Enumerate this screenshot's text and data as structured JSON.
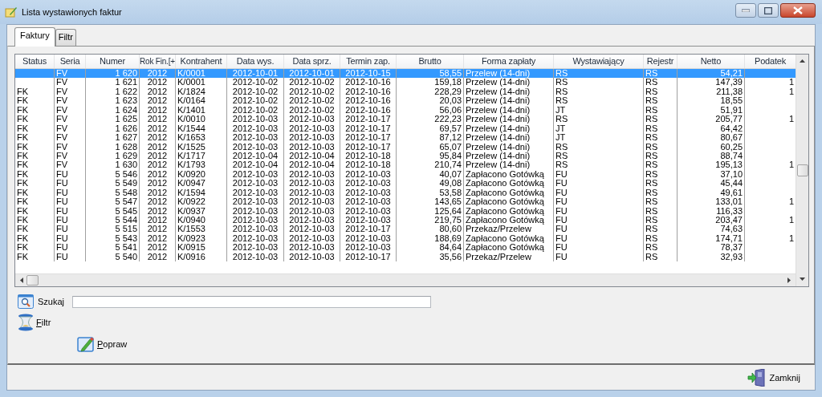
{
  "window": {
    "title": "Lista wystawionych faktur"
  },
  "tabs": [
    {
      "label": "Faktury",
      "selected": true
    },
    {
      "label": "Filtr",
      "selected": false
    }
  ],
  "table": {
    "columns": [
      "Status",
      "Seria",
      "Numer",
      "Rok Fin.[+",
      "Kontrahent",
      "Data wys.",
      "Data sprz.",
      "Termin zap.",
      "Brutto",
      "Forma zapłaty",
      "Wystawiający",
      "Rejestr",
      "Netto",
      "Podatek"
    ],
    "rows": [
      {
        "selected": true,
        "seria": "FV",
        "numer": "1 620",
        "rok": "2012",
        "kontrahent": "K/0001",
        "data_wys": "2012-10-01",
        "data_sprz": "2012-10-01",
        "termin": "2012-10-15",
        "brutto": "58,55",
        "forma": "Przelew (14-dni)",
        "wystawiajacy": "RS",
        "rejestr": "RS",
        "netto": "54,21"
      },
      {
        "selected": false,
        "seria": "FV",
        "numer": "1 621",
        "rok": "2012",
        "kontrahent": "K/0001",
        "data_wys": "2012-10-02",
        "data_sprz": "2012-10-02",
        "termin": "2012-10-16",
        "brutto": "159,18",
        "forma": "Przelew (14-dni)",
        "wystawiajacy": "RS",
        "rejestr": "RS",
        "netto": "147,39",
        "podatek": "1"
      },
      {
        "selected": false,
        "status": "FK",
        "seria": "FV",
        "numer": "1 622",
        "rok": "2012",
        "kontrahent": "K/1824",
        "data_wys": "2012-10-02",
        "data_sprz": "2012-10-02",
        "termin": "2012-10-16",
        "brutto": "228,29",
        "forma": "Przelew (14-dni)",
        "wystawiajacy": "RS",
        "rejestr": "RS",
        "netto": "211,38",
        "podatek": "1"
      },
      {
        "selected": false,
        "status": "FK",
        "seria": "FV",
        "numer": "1 623",
        "rok": "2012",
        "kontrahent": "K/0164",
        "data_wys": "2012-10-02",
        "data_sprz": "2012-10-02",
        "termin": "2012-10-16",
        "brutto": "20,03",
        "forma": "Przelew (14-dni)",
        "wystawiajacy": "RS",
        "rejestr": "RS",
        "netto": "18,55"
      },
      {
        "selected": false,
        "status": "FK",
        "seria": "FV",
        "numer": "1 624",
        "rok": "2012",
        "kontrahent": "K/1401",
        "data_wys": "2012-10-02",
        "data_sprz": "2012-10-02",
        "termin": "2012-10-16",
        "brutto": "56,06",
        "forma": "Przelew (14-dni)",
        "wystawiajacy": "JT",
        "rejestr": "RS",
        "netto": "51,91"
      },
      {
        "selected": false,
        "status": "FK",
        "seria": "FV",
        "numer": "1 625",
        "rok": "2012",
        "kontrahent": "K/0010",
        "data_wys": "2012-10-03",
        "data_sprz": "2012-10-03",
        "termin": "2012-10-17",
        "brutto": "222,23",
        "forma": "Przelew (14-dni)",
        "wystawiajacy": "RS",
        "rejestr": "RS",
        "netto": "205,77",
        "podatek": "1"
      },
      {
        "selected": false,
        "status": "FK",
        "seria": "FV",
        "numer": "1 626",
        "rok": "2012",
        "kontrahent": "K/1544",
        "data_wys": "2012-10-03",
        "data_sprz": "2012-10-03",
        "termin": "2012-10-17",
        "brutto": "69,57",
        "forma": "Przelew (14-dni)",
        "wystawiajacy": "JT",
        "rejestr": "RS",
        "netto": "64,42"
      },
      {
        "selected": false,
        "status": "FK",
        "seria": "FV",
        "numer": "1 627",
        "rok": "2012",
        "kontrahent": "K/1653",
        "data_wys": "2012-10-03",
        "data_sprz": "2012-10-03",
        "termin": "2012-10-17",
        "brutto": "87,12",
        "forma": "Przelew (14-dni)",
        "wystawiajacy": "JT",
        "rejestr": "RS",
        "netto": "80,67"
      },
      {
        "selected": false,
        "status": "FK",
        "seria": "FV",
        "numer": "1 628",
        "rok": "2012",
        "kontrahent": "K/1525",
        "data_wys": "2012-10-03",
        "data_sprz": "2012-10-03",
        "termin": "2012-10-17",
        "brutto": "65,07",
        "forma": "Przelew (14-dni)",
        "wystawiajacy": "RS",
        "rejestr": "RS",
        "netto": "60,25"
      },
      {
        "selected": false,
        "status": "FK",
        "seria": "FV",
        "numer": "1 629",
        "rok": "2012",
        "kontrahent": "K/1717",
        "data_wys": "2012-10-04",
        "data_sprz": "2012-10-04",
        "termin": "2012-10-18",
        "brutto": "95,84",
        "forma": "Przelew (14-dni)",
        "wystawiajacy": "RS",
        "rejestr": "RS",
        "netto": "88,74"
      },
      {
        "selected": false,
        "status": "FK",
        "seria": "FV",
        "numer": "1 630",
        "rok": "2012",
        "kontrahent": "K/1793",
        "data_wys": "2012-10-04",
        "data_sprz": "2012-10-04",
        "termin": "2012-10-18",
        "brutto": "210,74",
        "forma": "Przelew (14-dni)",
        "wystawiajacy": "RS",
        "rejestr": "RS",
        "netto": "195,13",
        "podatek": "1"
      },
      {
        "selected": false,
        "status": "FK",
        "seria": "FU",
        "numer": "5 546",
        "rok": "2012",
        "kontrahent": "K/0920",
        "data_wys": "2012-10-03",
        "data_sprz": "2012-10-03",
        "termin": "2012-10-03",
        "brutto": "40,07",
        "forma": "Zapłacono Gotówką",
        "wystawiajacy": "FU",
        "rejestr": "RS",
        "netto": "37,10"
      },
      {
        "selected": false,
        "status": "FK",
        "seria": "FU",
        "numer": "5 549",
        "rok": "2012",
        "kontrahent": "K/0947",
        "data_wys": "2012-10-03",
        "data_sprz": "2012-10-03",
        "termin": "2012-10-03",
        "brutto": "49,08",
        "forma": "Zapłacono Gotówką",
        "wystawiajacy": "FU",
        "rejestr": "RS",
        "netto": "45,44"
      },
      {
        "selected": false,
        "status": "FK",
        "seria": "FU",
        "numer": "5 548",
        "rok": "2012",
        "kontrahent": "K/1594",
        "data_wys": "2012-10-03",
        "data_sprz": "2012-10-03",
        "termin": "2012-10-03",
        "brutto": "53,58",
        "forma": "Zapłacono Gotówką",
        "wystawiajacy": "FU",
        "rejestr": "RS",
        "netto": "49,61"
      },
      {
        "selected": false,
        "status": "FK",
        "seria": "FU",
        "numer": "5 547",
        "rok": "2012",
        "kontrahent": "K/0922",
        "data_wys": "2012-10-03",
        "data_sprz": "2012-10-03",
        "termin": "2012-10-03",
        "brutto": "143,65",
        "forma": "Zapłacono Gotówką",
        "wystawiajacy": "FU",
        "rejestr": "RS",
        "netto": "133,01",
        "podatek": "1"
      },
      {
        "selected": false,
        "status": "FK",
        "seria": "FU",
        "numer": "5 545",
        "rok": "2012",
        "kontrahent": "K/0937",
        "data_wys": "2012-10-03",
        "data_sprz": "2012-10-03",
        "termin": "2012-10-03",
        "brutto": "125,64",
        "forma": "Zapłacono Gotówką",
        "wystawiajacy": "FU",
        "rejestr": "RS",
        "netto": "116,33"
      },
      {
        "selected": false,
        "status": "FK",
        "seria": "FU",
        "numer": "5 544",
        "rok": "2012",
        "kontrahent": "K/0940",
        "data_wys": "2012-10-03",
        "data_sprz": "2012-10-03",
        "termin": "2012-10-03",
        "brutto": "219,75",
        "forma": "Zapłacono Gotówką",
        "wystawiajacy": "FU",
        "rejestr": "RS",
        "netto": "203,47",
        "podatek": "1"
      },
      {
        "selected": false,
        "status": "FK",
        "seria": "FU",
        "numer": "5 515",
        "rok": "2012",
        "kontrahent": "K/1553",
        "data_wys": "2012-10-03",
        "data_sprz": "2012-10-03",
        "termin": "2012-10-17",
        "brutto": "80,60",
        "forma": "Przekaz/Przelew",
        "wystawiajacy": "FU",
        "rejestr": "RS",
        "netto": "74,63"
      },
      {
        "selected": false,
        "status": "FK",
        "seria": "FU",
        "numer": "5 543",
        "rok": "2012",
        "kontrahent": "K/0923",
        "data_wys": "2012-10-03",
        "data_sprz": "2012-10-03",
        "termin": "2012-10-03",
        "brutto": "188,69",
        "forma": "Zapłacono Gotówką",
        "wystawiajacy": "FU",
        "rejestr": "RS",
        "netto": "174,71",
        "podatek": "1"
      },
      {
        "selected": false,
        "status": "FK",
        "seria": "FU",
        "numer": "5 541",
        "rok": "2012",
        "kontrahent": "K/0915",
        "data_wys": "2012-10-03",
        "data_sprz": "2012-10-03",
        "termin": "2012-10-03",
        "brutto": "84,64",
        "forma": "Zapłacono Gotówką",
        "wystawiajacy": "FU",
        "rejestr": "RS",
        "netto": "78,37"
      },
      {
        "selected": false,
        "status": "FK",
        "seria": "FU",
        "numer": "5 540",
        "rok": "2012",
        "kontrahent": "K/0916",
        "data_wys": "2012-10-03",
        "data_sprz": "2012-10-03",
        "termin": "2012-10-17",
        "brutto": "35,56",
        "forma": "Przekaz/Przelew",
        "wystawiajacy": "FU",
        "rejestr": "RS",
        "netto": "32,93"
      }
    ]
  },
  "search": {
    "label": "Szukaj"
  },
  "filter_button": {
    "label": "Filtr"
  },
  "edit_button": {
    "label": "Popraw"
  },
  "close_button": {
    "label": "Zamknij"
  }
}
